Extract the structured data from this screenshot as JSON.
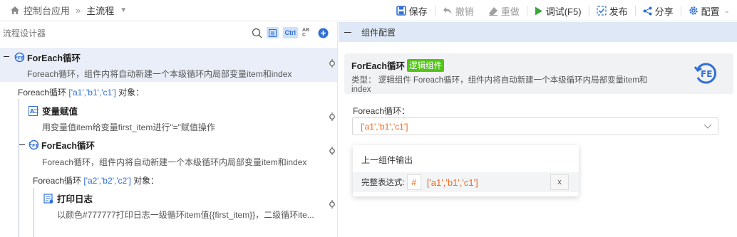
{
  "breadcrumb": {
    "app": "控制台应用",
    "current": "主流程"
  },
  "toolbar": {
    "save": "保存",
    "undo": "撤销",
    "redo": "重做",
    "debug": "调试(F5)",
    "publish": "发布",
    "share": "分享",
    "config": "配置"
  },
  "designer": {
    "title": "流程设计器",
    "ctrl_label": "Ctrl",
    "abc_label": "AB C"
  },
  "tree": {
    "n1": {
      "title": "ForEach循环",
      "desc": "Foreach循环，组件内将自动新建一个本级循环内局部变量item和index"
    },
    "loop1_label_prefix": "Foreach循环",
    "loop1_value": "['a1','b1','c1']",
    "loop1_label_suffix": "对象：",
    "n2": {
      "title": "变量赋值",
      "desc": "用变量值item给变量first_item进行\"=\"赋值操作"
    },
    "n3": {
      "title": "ForEach循环",
      "desc": "Foreach循环，组件内将自动新建一个本级循环内局部变量item和index"
    },
    "loop2_label_prefix": "Foreach循环",
    "loop2_value": "['a2','b2','c2']",
    "loop2_label_suffix": "对象：",
    "n4": {
      "title": "打印日志",
      "desc": "以颜色#777777打印日志一级循环item值{{first_item}}，二级循环ite..."
    }
  },
  "config": {
    "section_title": "组件配置",
    "card_title": "ForEach循环",
    "card_tag": "逻辑组件",
    "card_type_label": "类型：",
    "card_desc": "逻辑组件 Foreach循环，组件内将自动新建一个本级循环内局部变量item和index",
    "field_label": "Foreach循环：",
    "field_value": "['a1','b1','c1']",
    "popup_title": "上一组件输出",
    "popup_expr_label": "完整表达式:",
    "popup_hash": "#",
    "popup_expr": "['a1','b1','c1']",
    "popup_clear": "x"
  },
  "colors": {
    "accent": "#2f6fd6",
    "tag": "#52c41a",
    "value": "#f06a1d",
    "section": "#dfe8f6"
  }
}
